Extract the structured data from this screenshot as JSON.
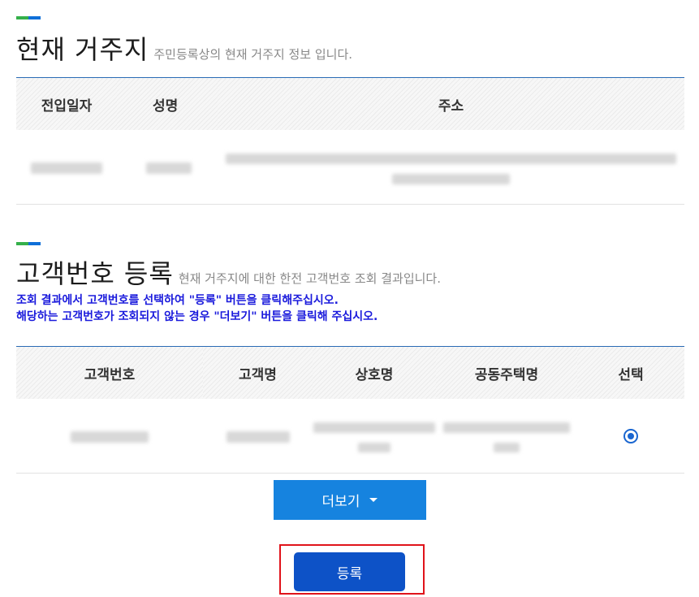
{
  "current_address": {
    "title": "현재 거주지",
    "subtitle": "주민등록상의 현재 거주지 정보 입니다.",
    "columns": [
      "전입일자",
      "성명",
      "주소"
    ]
  },
  "customer_registration": {
    "title": "고객번호 등록",
    "subtitle": "현재 거주지에 대한 한전 고객번호 조회 결과입니다.",
    "notice_line1": "조회 결과에서 고객번호를 선택하여 \"등록\" 버튼을 클릭해주십시오.",
    "notice_line2": "해당하는 고객번호가 조회되지 않는 경우 \"더보기\" 버튼을 클릭해 주십시오.",
    "columns": [
      "고객번호",
      "고객명",
      "상호명",
      "공동주택명",
      "선택"
    ],
    "row_selected": true
  },
  "buttons": {
    "more_label": "더보기",
    "register_label": "등록"
  },
  "colors": {
    "accent_green": "#35b04a",
    "accent_blue": "#0f6fd8",
    "notice_text": "#1a1adc",
    "more_button": "#1683df",
    "register_button": "#0d52c7",
    "highlight_frame": "#e0131a"
  }
}
